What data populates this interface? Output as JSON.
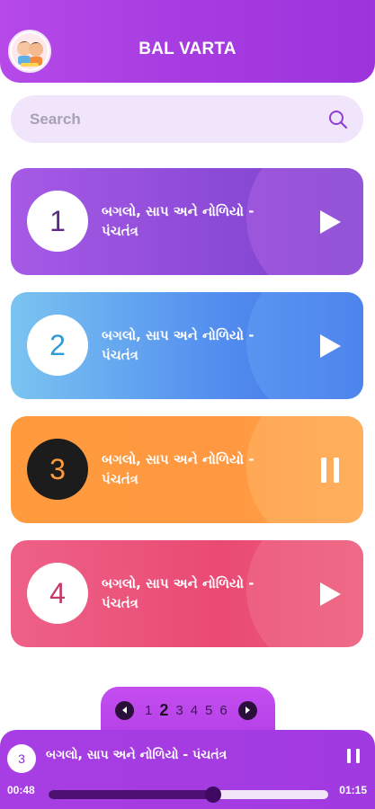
{
  "header": {
    "title": "BAL VARTA",
    "logo_icon": "bal-varta-logo-icon"
  },
  "search": {
    "placeholder": "Search",
    "icon": "search-icon"
  },
  "stories": [
    {
      "number": "1",
      "title": "બગલો, સાપ અને નોળિયો - પંચતંત્ર",
      "action": "play",
      "number_color": "#5b2a8a"
    },
    {
      "number": "2",
      "title": "બગલો, સાપ અને નોળિયો - પંચતંત્ર",
      "action": "play",
      "number_color": "#2f9bd6"
    },
    {
      "number": "3",
      "title": "બગલો, સાપ અને નોળિયો - પંચતંત્ર",
      "action": "pause",
      "number_color": "#ff9a3c"
    },
    {
      "number": "4",
      "title": "બગલો, સાપ અને નોળિયો - પંચતંત્ર",
      "action": "play",
      "number_color": "#c23a64"
    }
  ],
  "pagination": {
    "pages": [
      "1",
      "2",
      "3",
      "4",
      "5",
      "6"
    ],
    "current": "2"
  },
  "player": {
    "number": "3",
    "title": "બગલો, સાપ અને નોળિયો - પંચતંત્ર",
    "current_time": "00:48",
    "total_time": "01:15",
    "progress": 0.59
  }
}
